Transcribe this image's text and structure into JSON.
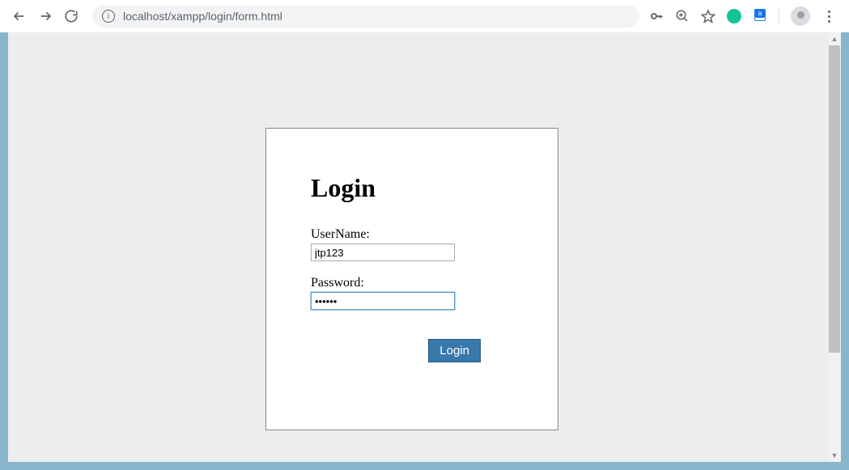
{
  "browser": {
    "url": "localhost/xampp/login/form.html"
  },
  "form": {
    "title": "Login",
    "username_label": "UserName:",
    "username_value": "jtp123",
    "password_label": "Password:",
    "password_value": "••••••",
    "submit_label": "Login"
  }
}
